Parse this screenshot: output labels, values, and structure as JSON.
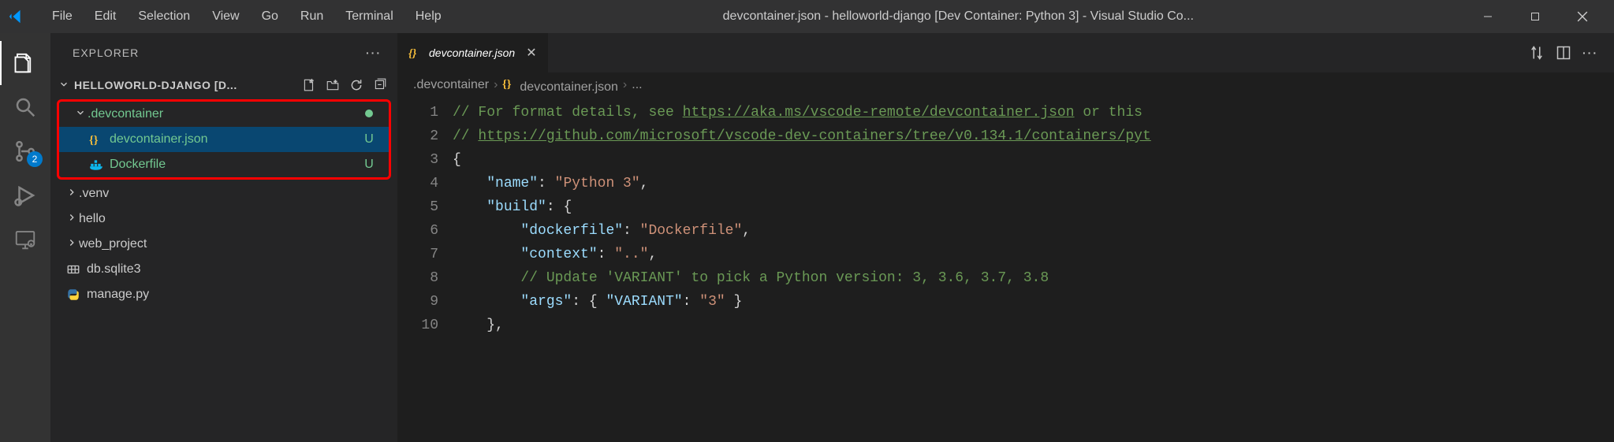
{
  "titlebar": {
    "menu": [
      "File",
      "Edit",
      "Selection",
      "View",
      "Go",
      "Run",
      "Terminal",
      "Help"
    ],
    "title": "devcontainer.json - helloworld-django [Dev Container: Python 3] - Visual Studio Co..."
  },
  "activitybar": {
    "scm_badge": "2"
  },
  "sidebar": {
    "title": "EXPLORER",
    "section_title": "HELLOWORLD-DJANGO [D...",
    "tree": [
      {
        "kind": "folder",
        "name": ".devcontainer",
        "expanded": true,
        "git": "dot",
        "depth": 0,
        "annotated": true
      },
      {
        "kind": "file",
        "name": "devcontainer.json",
        "icon": "json",
        "git": "U",
        "depth": 1,
        "selected": true,
        "annotated": true
      },
      {
        "kind": "file",
        "name": "Dockerfile",
        "icon": "docker",
        "git": "U",
        "depth": 1,
        "annotated": true
      },
      {
        "kind": "folder",
        "name": ".venv",
        "expanded": false,
        "depth": 0
      },
      {
        "kind": "folder",
        "name": "hello",
        "expanded": false,
        "depth": 0
      },
      {
        "kind": "folder",
        "name": "web_project",
        "expanded": false,
        "depth": 0
      },
      {
        "kind": "file",
        "name": "db.sqlite3",
        "icon": "db",
        "depth": 0
      },
      {
        "kind": "file",
        "name": "manage.py",
        "icon": "python",
        "depth": 0
      }
    ],
    "git_color": "#73c991"
  },
  "editor": {
    "tab": {
      "name": "devcontainer.json",
      "icon": "json"
    },
    "breadcrumbs": [
      {
        "label": ".devcontainer"
      },
      {
        "label": "devcontainer.json",
        "icon": "json"
      },
      {
        "label": "..."
      }
    ],
    "line_numbers": [
      "1",
      "2",
      "3",
      "4",
      "5",
      "6",
      "7",
      "8",
      "9",
      "10"
    ],
    "code_lines": [
      [
        {
          "t": "cm",
          "v": "// For format details, see "
        },
        {
          "t": "link",
          "v": "https://aka.ms/vscode-remote/devcontainer.json"
        },
        {
          "t": "cm",
          "v": " or this "
        }
      ],
      [
        {
          "t": "cm",
          "v": "// "
        },
        {
          "t": "link",
          "v": "https://github.com/microsoft/vscode-dev-containers/tree/v0.134.1/containers/pyt"
        }
      ],
      [
        {
          "t": "pun",
          "v": "{"
        }
      ],
      [
        {
          "t": "pun",
          "v": "    "
        },
        {
          "t": "key",
          "v": "\"name\""
        },
        {
          "t": "pun",
          "v": ": "
        },
        {
          "t": "str",
          "v": "\"Python 3\""
        },
        {
          "t": "pun",
          "v": ","
        }
      ],
      [
        {
          "t": "pun",
          "v": "    "
        },
        {
          "t": "key",
          "v": "\"build\""
        },
        {
          "t": "pun",
          "v": ": {"
        }
      ],
      [
        {
          "t": "pun",
          "v": "        "
        },
        {
          "t": "key",
          "v": "\"dockerfile\""
        },
        {
          "t": "pun",
          "v": ": "
        },
        {
          "t": "str",
          "v": "\"Dockerfile\""
        },
        {
          "t": "pun",
          "v": ","
        }
      ],
      [
        {
          "t": "pun",
          "v": "        "
        },
        {
          "t": "key",
          "v": "\"context\""
        },
        {
          "t": "pun",
          "v": ": "
        },
        {
          "t": "str",
          "v": "\"..\""
        },
        {
          "t": "pun",
          "v": ","
        }
      ],
      [
        {
          "t": "pun",
          "v": "        "
        },
        {
          "t": "cm",
          "v": "// Update 'VARIANT' to pick a Python version: 3, 3.6, 3.7, 3.8"
        }
      ],
      [
        {
          "t": "pun",
          "v": "        "
        },
        {
          "t": "key",
          "v": "\"args\""
        },
        {
          "t": "pun",
          "v": ": { "
        },
        {
          "t": "key",
          "v": "\"VARIANT\""
        },
        {
          "t": "pun",
          "v": ": "
        },
        {
          "t": "str",
          "v": "\"3\""
        },
        {
          "t": "pun",
          "v": " }"
        }
      ],
      [
        {
          "t": "pun",
          "v": "    },"
        }
      ]
    ]
  }
}
